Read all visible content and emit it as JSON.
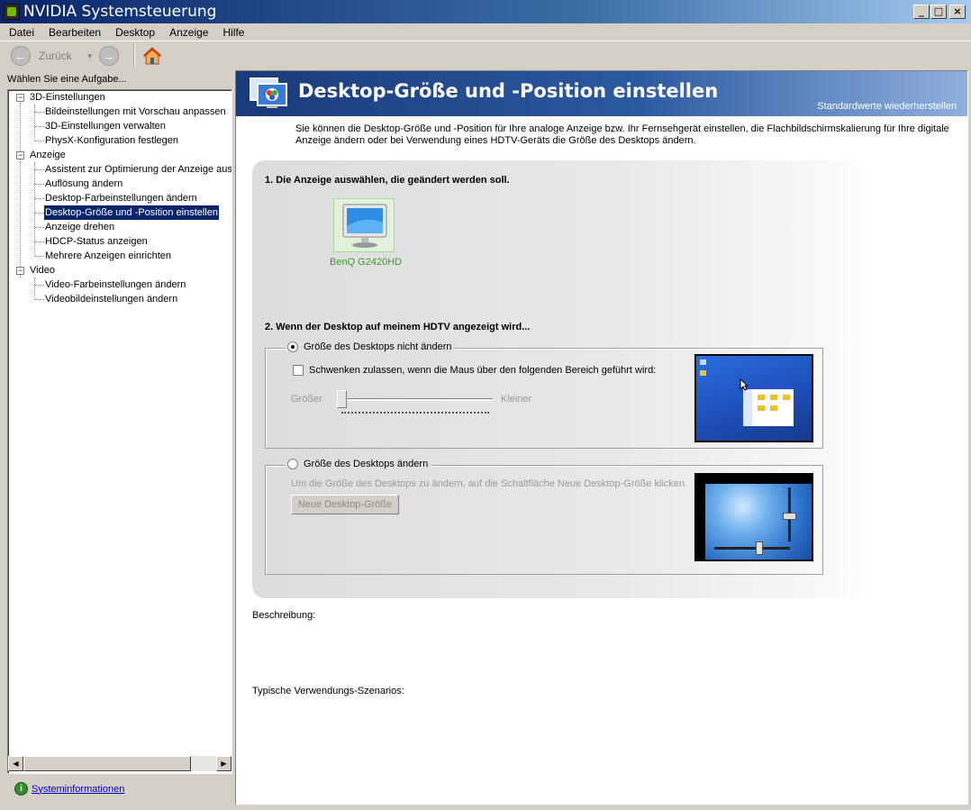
{
  "window": {
    "title": "NVIDIA Systemsteuerung"
  },
  "menu": [
    "Datei",
    "Bearbeiten",
    "Desktop",
    "Anzeige",
    "Hilfe"
  ],
  "toolbar": {
    "back_label": "Zurück"
  },
  "sidebar": {
    "header": "Wählen Sie eine Aufgabe...",
    "groups": [
      {
        "label": "3D-Einstellungen",
        "items": [
          "Bildeinstellungen mit Vorschau anpassen",
          "3D-Einstellungen verwalten",
          "PhysX-Konfiguration festlegen"
        ]
      },
      {
        "label": "Anzeige",
        "items": [
          "Assistent zur Optimierung der Anzeige ausf",
          "Auflösung ändern",
          "Desktop-Farbeinstellungen ändern",
          "Desktop-Größe und -Position einstellen",
          "Anzeige drehen",
          "HDCP-Status anzeigen",
          "Mehrere Anzeigen einrichten"
        ]
      },
      {
        "label": "Video",
        "items": [
          "Video-Farbeinstellungen ändern",
          "Videobildeinstellungen ändern"
        ]
      }
    ],
    "selected": "Desktop-Größe und -Position einstellen",
    "footer_link": "Systeminformationen"
  },
  "main": {
    "title": "Desktop-Größe und -Position einstellen",
    "restore_defaults": "Standardwerte wiederherstellen",
    "intro": "Sie können die Desktop-Größe und -Position für Ihre analoge Anzeige bzw. Ihr Fernsehgerät einstellen, die Flachbildschirmskalierung für Ihre digitale Anzeige ändern oder bei Verwendung eines HDTV-Geräts die Größe des Desktops ändern.",
    "step1": {
      "title": "1. Die Anzeige auswählen, die geändert werden soll.",
      "display_name": "BenQ G2420HD"
    },
    "step2": {
      "title": "2. Wenn der Desktop auf meinem HDTV angezeigt wird...",
      "option1": {
        "label": "Größe des Desktops nicht ändern",
        "checked": true,
        "checkbox_label": "Schwenken zulassen, wenn die Maus über den folgenden Bereich geführt wird:",
        "checkbox_checked": false,
        "slider_min_label": "Größer",
        "slider_max_label": "Kleiner",
        "slider_value": 0
      },
      "option2": {
        "label": "Größe des Desktops ändern",
        "checked": false,
        "hint": "Um die Größe des Desktops zu ändern, auf die Schaltfläche Neue Desktop-Größe klicken.",
        "button_label": "Neue Desktop-Größe"
      }
    },
    "description_label": "Beschreibung:",
    "scenarios_label": "Typische Verwendungs-Szenarios:"
  },
  "colors": {
    "accent_green": "#76b900",
    "banner_blue": "#1a3a7a",
    "selection": "#0a246a",
    "link": "#0000cc"
  }
}
